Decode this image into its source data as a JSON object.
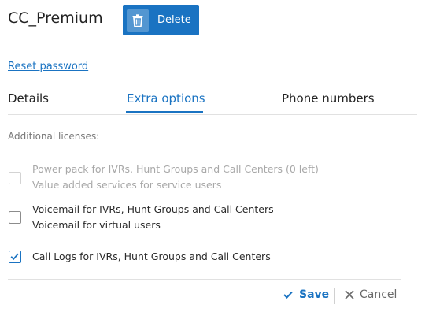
{
  "header": {
    "title": "CC_Premium",
    "delete_label": "Delete",
    "delete_icon": "trash-icon"
  },
  "reset_password_label": "Reset password",
  "tabs": [
    {
      "label": "Details",
      "active": false
    },
    {
      "label": "Extra options",
      "active": true
    },
    {
      "label": "Phone numbers",
      "active": false
    }
  ],
  "licenses": {
    "section_label": "Additional licenses:",
    "options": [
      {
        "line1": "Power pack for IVRs, Hunt Groups and Call Centers (0 left)",
        "line2": "Value added services for service users",
        "checked": false,
        "disabled": true
      },
      {
        "line1": "Voicemail for IVRs, Hunt Groups and Call Centers",
        "line2": "Voicemail for virtual users",
        "checked": false,
        "disabled": false
      },
      {
        "line1": "Call Logs for IVRs, Hunt Groups and Call Centers",
        "checked": true,
        "disabled": false
      }
    ]
  },
  "footer": {
    "save_label": "Save",
    "cancel_label": "Cancel"
  },
  "colors": {
    "accent": "#1a73c2",
    "disabled_text": "#a8a8a8"
  }
}
